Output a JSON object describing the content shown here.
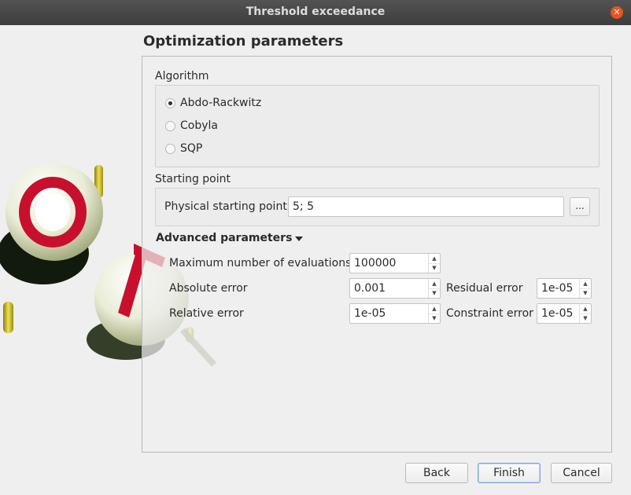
{
  "window": {
    "title": "Threshold exceedance"
  },
  "page": {
    "title": "Optimization parameters"
  },
  "algorithm": {
    "label": "Algorithm",
    "options": [
      {
        "label": "Abdo-Rackwitz",
        "checked": true
      },
      {
        "label": "Cobyla",
        "checked": false
      },
      {
        "label": "SQP",
        "checked": false
      }
    ]
  },
  "starting_point": {
    "label": "Starting point",
    "field_label": "Physical starting point",
    "value": "5; 5",
    "browse_label": "..."
  },
  "advanced": {
    "label": "Advanced parameters",
    "max_evaluations": {
      "label": "Maximum number of evaluations",
      "value": "100000"
    },
    "absolute_error": {
      "label": "Absolute error",
      "value": "0.001"
    },
    "residual_error": {
      "label": "Residual error",
      "value": "1e-05"
    },
    "relative_error": {
      "label": "Relative error",
      "value": "1e-05"
    },
    "constraint_error": {
      "label": "Constraint error",
      "value": "1e-05"
    }
  },
  "buttons": {
    "back": "Back",
    "finish": "Finish",
    "cancel": "Cancel"
  },
  "icons": {
    "close": "close-icon",
    "spin_up": "arrow-up-icon",
    "spin_down": "arrow-down-icon",
    "expand": "caret-down-icon"
  },
  "colors": {
    "close_button": "#e95420",
    "titlebar": "#454545",
    "logo_red": "#c8102e"
  }
}
